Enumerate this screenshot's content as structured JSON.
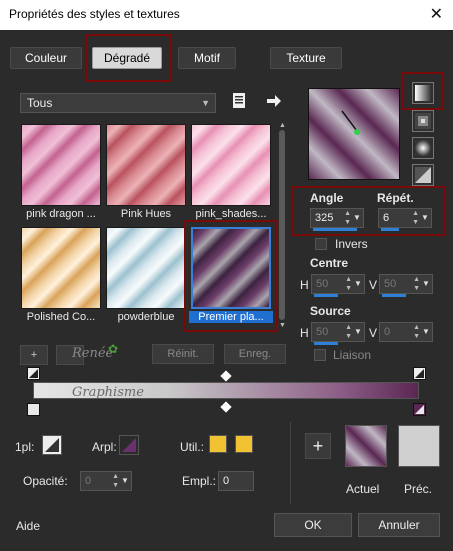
{
  "window": {
    "title": "Propriétés des styles et textures",
    "close_glyph": "✕"
  },
  "tabs": [
    {
      "label": "Couleur",
      "active": false
    },
    {
      "label": "Dégradé",
      "active": true
    },
    {
      "label": "Motif",
      "active": false
    },
    {
      "label": "Texture",
      "active": false
    }
  ],
  "library": {
    "dropdown_value": "Tous",
    "gradients": [
      {
        "label": "pink dragon ...",
        "colors": [
          "#e7a7c7",
          "#c2628f",
          "#f0bfd6"
        ]
      },
      {
        "label": "Pink Hues",
        "colors": [
          "#d98a92",
          "#b9525e",
          "#ecb2b5"
        ]
      },
      {
        "label": "pink_shades...",
        "colors": [
          "#f5c3d6",
          "#e890b4",
          "#fbe0ea"
        ]
      },
      {
        "label": "Polished Co...",
        "colors": [
          "#f2d3a5",
          "#d9a35a",
          "#fff1dc"
        ]
      },
      {
        "label": "powderblue",
        "colors": [
          "#d9e8ee",
          "#9cc1cf",
          "#f7fbfc"
        ]
      },
      {
        "label": "Premier pla...",
        "colors": [
          "#3d2340",
          "#a9a5ad",
          "#6b3d68"
        ],
        "selected": true
      }
    ],
    "buttons": {
      "add": "+",
      "reset": "Réinit.",
      "save": "Enreg."
    },
    "watermark": [
      "Renée",
      "Graphisme"
    ]
  },
  "controls": {
    "angle_label": "Angle",
    "angle_value": "325",
    "repeat_label": "Répét.",
    "repeat_value": "6",
    "invert_label": "Invers",
    "center_label": "Centre",
    "center_h": "50",
    "center_v": "50",
    "source_label": "Source",
    "source_h": "50",
    "source_v": "0",
    "h_label": "H",
    "v_label": "V",
    "link_label": "Liaison"
  },
  "editor": {
    "gradient_colors": [
      "#e6e6e6",
      "#c9c9c9",
      "#8c5d86",
      "#5a2752"
    ]
  },
  "bottom": {
    "foreground_label": "1pl:",
    "arpl_label": "Arpl:",
    "util_label": "Util.:",
    "util_colors": [
      "#f1c232",
      "#f1c232"
    ],
    "opacity_label": "Opacité:",
    "opacity_value": "0",
    "location_label": "Empl.:",
    "location_value": "0",
    "add_swatch": "+",
    "current_label": "Actuel",
    "previous_label": "Préc."
  },
  "footer": {
    "help": "Aide",
    "ok": "OK",
    "cancel": "Annuler"
  }
}
